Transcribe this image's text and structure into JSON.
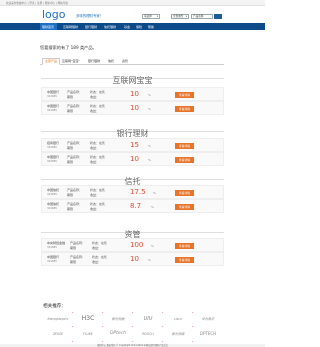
{
  "topbar": {
    "text": "欢迎来到金融中心 | 登录 | 注册 | 帮助中心 | 网站导航"
  },
  "header": {
    "logo": "logo",
    "slogan": "多味的理财专家！",
    "select1": "请选择",
    "select2": "全部类型",
    "select3": "产品名称"
  },
  "nav": {
    "items": [
      "理财首页",
      "互联网理财",
      "银行理财",
      "信托理财",
      "基金",
      "保险",
      "帮助"
    ]
  },
  "results": {
    "title": "您要搜索的有了 189 类产品。"
  },
  "tabs": [
    "全部产品",
    "互联网“宝宝”",
    "银行理财",
    "信托",
    "资管"
  ],
  "sections": [
    {
      "title": "互联网宝宝",
      "rows": [
        {
          "bank": "中国银行",
          "code": "324685",
          "c1": "产品名称：",
          "c1b": "期限",
          "c2": "状态：在售",
          "c2b": "收益：",
          "value": "10",
          "unit": "%",
          "button": "查看详情"
        },
        {
          "bank": "中国银行",
          "code": "324685",
          "c1": "产品名称：",
          "c1b": "期限",
          "c2": "状态：在售",
          "c2b": "收益：",
          "value": "10",
          "unit": "%",
          "button": "查看详情"
        }
      ]
    },
    {
      "title": "银行理财",
      "rows": [
        {
          "bank": "招商银行",
          "code": "324685",
          "c1": "产品名称：",
          "c1b": "期限",
          "c2": "状态：在售",
          "c2b": "收益：",
          "value": "15",
          "unit": "%",
          "button": "查看详情"
        },
        {
          "bank": "中国银行",
          "code": "324685",
          "c1": "产品名称：",
          "c1b": "期限",
          "c2": "状态：在售",
          "c2b": "收益：",
          "value": "10",
          "unit": "%",
          "button": "查看详情"
        }
      ]
    },
    {
      "title": "信托",
      "rows": [
        {
          "bank": "中国信托",
          "code": "324685",
          "c1": "产品名称：",
          "c1b": "期限",
          "c2": "状态：在售",
          "c2b": "收益：",
          "value": "17.5",
          "unit": "%",
          "button": "查看详情"
        },
        {
          "bank": "中国信托",
          "code": "324685",
          "c1": "产品名称：",
          "c1b": "期限",
          "c2": "状态：在售",
          "c2b": "收益：",
          "value": "8.7",
          "unit": "%",
          "button": "查看详情"
        }
      ]
    },
    {
      "title": "资管",
      "rows": [
        {
          "bank": "中央财经金融",
          "code": "324685",
          "c1": "产品名称：",
          "c1b": "期限",
          "c2": "状态：在售",
          "c2b": "收益：",
          "value": "100",
          "unit": "%",
          "button": "查看详情"
        },
        {
          "bank": "中国银行",
          "code": "324685",
          "c1": "产品名称：",
          "c1b": "期限",
          "c2": "状态：在售",
          "c2b": "收益：",
          "value": "10",
          "unit": "%",
          "button": "查看详情"
        }
      ]
    }
  ],
  "recommend": {
    "title": "相关推荐：",
    "logos": [
      "Kamppanpirc",
      "H3C",
      "紫光锐捷",
      "UIU",
      "cisco",
      "华为数字",
      "ZFASE",
      "FLUKE",
      "DPtech",
      "BOSCH",
      "紫光网络",
      "DPTECH"
    ]
  },
  "footer": {
    "text": "理财中心 版权所有 © CopyRight 2014-2024 本网站提供理财产品信息"
  },
  "colors": {
    "nav": "#0d4a8a",
    "accent": "#e8742a",
    "value": "#e8482a",
    "brand": "#1b6fc2"
  }
}
